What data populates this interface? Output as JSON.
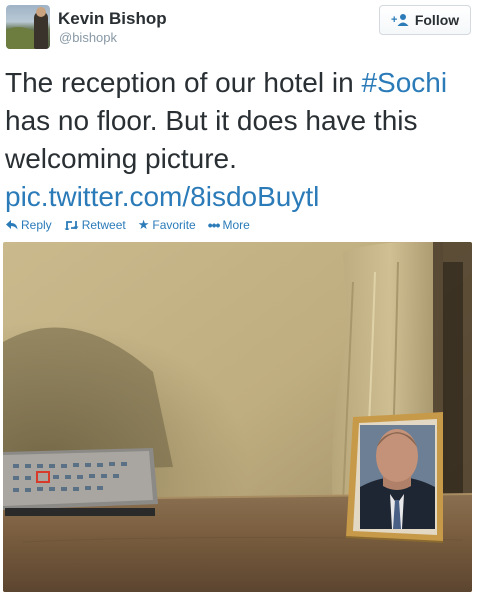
{
  "author": {
    "name": "Kevin Bishop",
    "handle": "@bishopk"
  },
  "follow_button": {
    "label": "Follow"
  },
  "tweet": {
    "text_before_hashtag": "The reception of our hotel in ",
    "hashtag": "#Sochi",
    "text_after_hashtag": " has no floor. But it does have this welcoming picture.",
    "link": "pic.twitter.com/8isdoBuytl"
  },
  "actions": {
    "reply": "Reply",
    "retweet": "Retweet",
    "favorite": "Favorite",
    "more": "More"
  },
  "icons": {
    "follow": "add-user-icon",
    "reply": "reply-arrow-icon",
    "retweet": "retweet-icon",
    "favorite": "star-icon",
    "more": "ellipsis-icon"
  },
  "colors": {
    "link": "#2b7bb9",
    "text": "#292f33",
    "muted": "#8899a6"
  }
}
